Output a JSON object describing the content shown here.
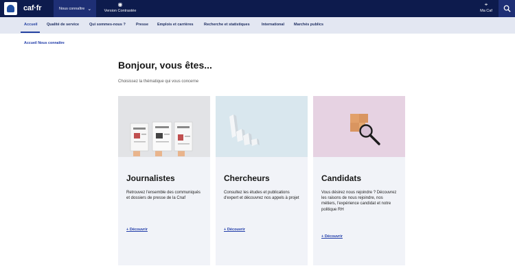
{
  "header": {
    "logo_text": "caf·fr",
    "nav_dropdown": "Nous connaître",
    "contrast_label": "Version Contrastée",
    "mycaf_label": "Ma Caf"
  },
  "subnav": {
    "items": [
      "Accueil",
      "Qualité de service",
      "Qui sommes-nous ?",
      "Presse",
      "Emplois et carrières",
      "Recherche et statistiques",
      "International",
      "Marchés publics"
    ],
    "active": "Accueil"
  },
  "breadcrumb": "Accueil Nous connaître",
  "main": {
    "title": "Bonjour, vous êtes...",
    "subtitle": "Choisissez la thématique qui vous concerne"
  },
  "cards": [
    {
      "title": "Journalistes",
      "description": "Retrouvez l'ensemble des communiqués et dossiers de presse de la Cnaf",
      "link": "+ Découvrir"
    },
    {
      "title": "Chercheurs",
      "description": "Consultez les études et publications d'expert et découvrez nos appels à projet",
      "link": "+ Découvrir"
    },
    {
      "title": "Candidats",
      "description": "Vous désirez nous rejoindre ? Découvrez les raisons de nous rejoindre, nos métiers, l'expérience candidat et notre politique RH",
      "link": "+ Découvrir"
    }
  ],
  "colors": {
    "header_bg": "#0d1b4d",
    "accent": "#1e3aa8",
    "subnav_bg": "#e3e7f2",
    "card_bg": "#f1f3f8"
  },
  "icons": [
    "caf-logo-icon",
    "chevron-down-icon",
    "eye-icon",
    "location-pin-icon",
    "search-icon"
  ]
}
